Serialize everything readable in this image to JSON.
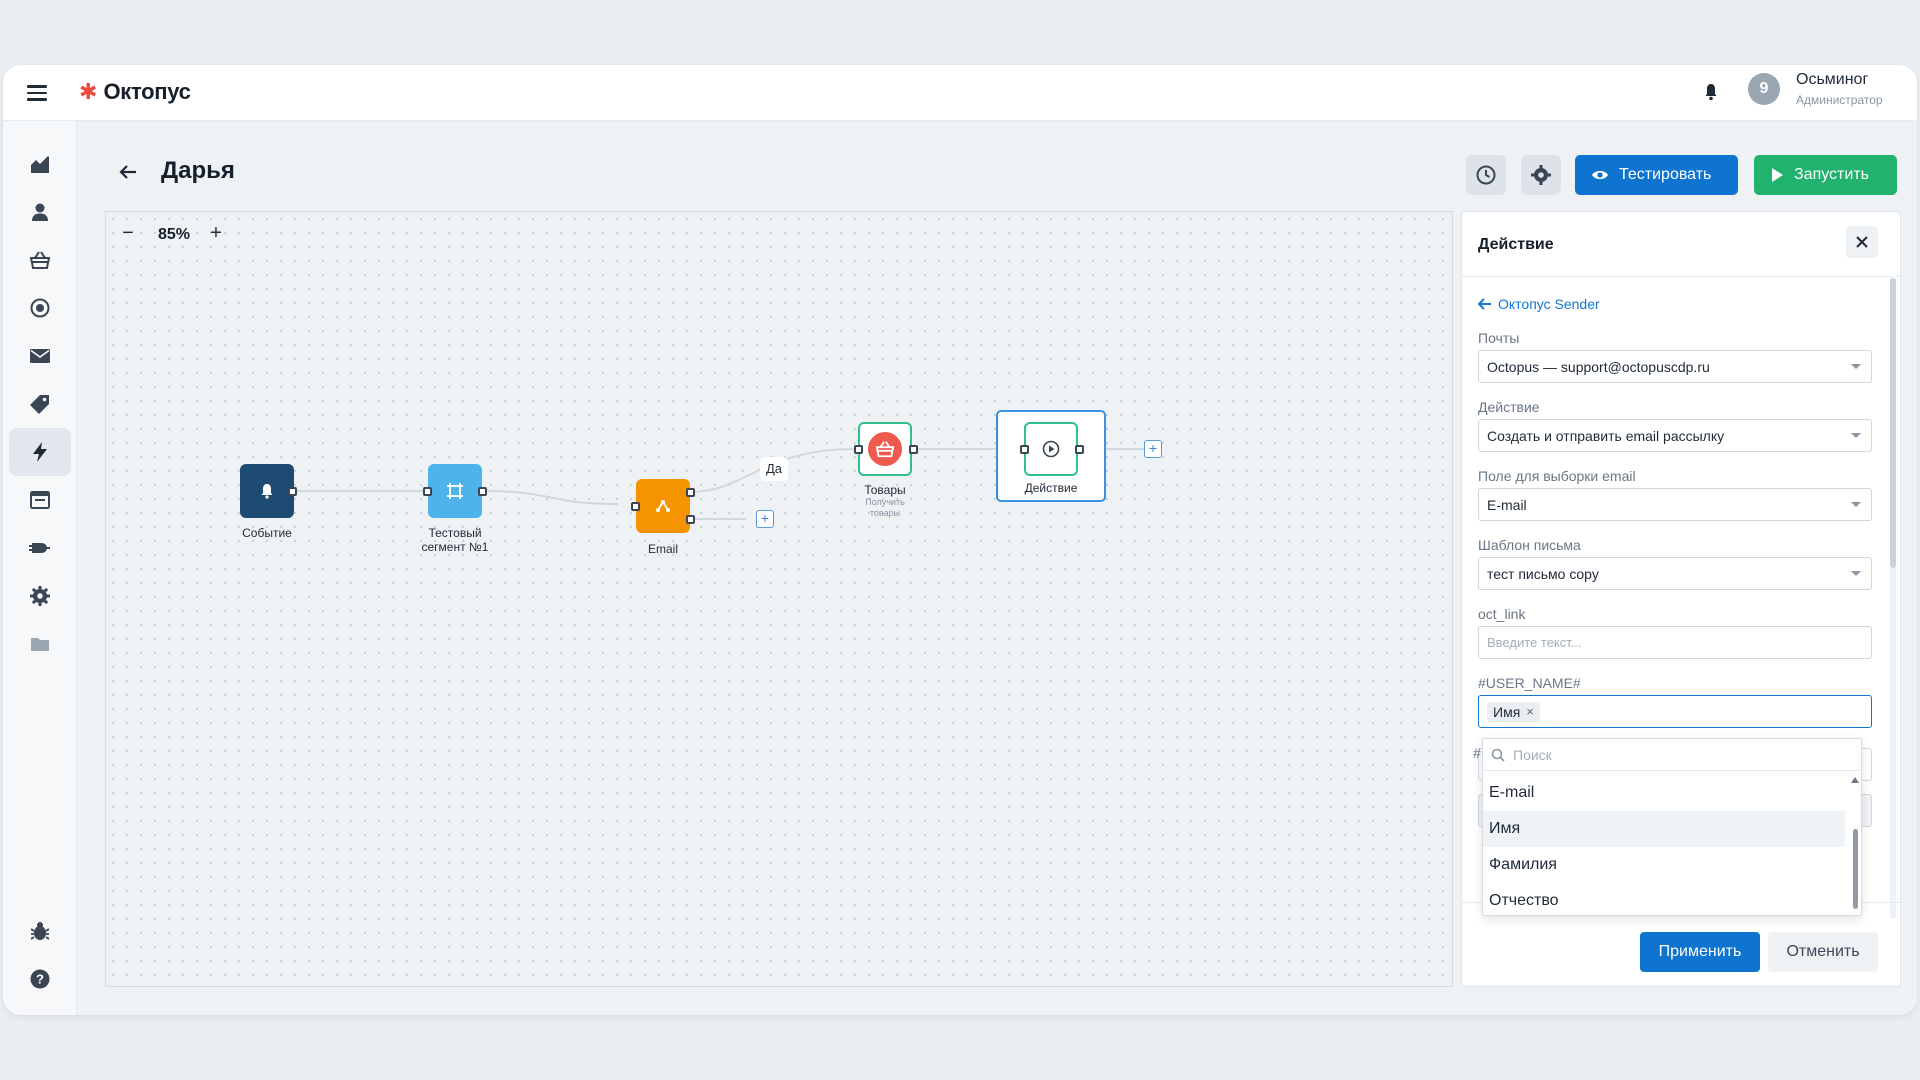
{
  "header": {
    "logo_text": "Октопус",
    "user": {
      "name": "Осьминог",
      "role": "Администратор",
      "avatar_letter": "9"
    }
  },
  "sidebar": {
    "items": [
      {
        "icon": "analytics-icon"
      },
      {
        "icon": "user-icon"
      },
      {
        "icon": "basket-icon"
      },
      {
        "icon": "target-icon"
      },
      {
        "icon": "mail-icon"
      },
      {
        "icon": "tag-icon"
      },
      {
        "icon": "lightning-icon",
        "active": true
      },
      {
        "icon": "forms-icon"
      },
      {
        "icon": "plug-icon"
      },
      {
        "icon": "gear-icon"
      },
      {
        "icon": "folder-icon"
      }
    ],
    "bottom": [
      {
        "icon": "bug-icon"
      },
      {
        "icon": "help-icon"
      }
    ]
  },
  "page": {
    "title": "Дарья",
    "test_label": "Тестировать",
    "run_label": "Запустить"
  },
  "canvas": {
    "zoom": "85%",
    "nodes": {
      "event": {
        "label": "Событие",
        "color": "#1d4b72"
      },
      "segment": {
        "label": "Тестовый сегмент №1",
        "color": "#4db3ea"
      },
      "email": {
        "label": "Email",
        "color": "#f59300"
      },
      "goods": {
        "label": "Товары",
        "sublabel": "Получить товары",
        "color": "#ee5a4e"
      },
      "action": {
        "label": "Действие",
        "color": "#2fbf8a"
      }
    },
    "branch_label": "Да"
  },
  "panel": {
    "title": "Действие",
    "back_link": "Октопус Sender",
    "fields": [
      {
        "label": "Почты",
        "value": "Octopus — support@octopuscdp.ru"
      },
      {
        "label": "Действие",
        "value": "Создать и отправить email рассылку"
      },
      {
        "label": "Поле для выборки email",
        "value": "E-mail"
      },
      {
        "label": "Шаблон письма",
        "value": "тест письмо copy"
      },
      {
        "label": "oct_link",
        "placeholder": "Введите текст..."
      },
      {
        "label": "#USER_NAME#",
        "chip": "Имя"
      }
    ],
    "hidden_label_char": "#",
    "dropdown": {
      "search_placeholder": "Поиск",
      "options": [
        "E-mail",
        "Имя",
        "Фамилия",
        "Отчество"
      ]
    },
    "apply_label": "Применить",
    "cancel_label": "Отменить"
  }
}
